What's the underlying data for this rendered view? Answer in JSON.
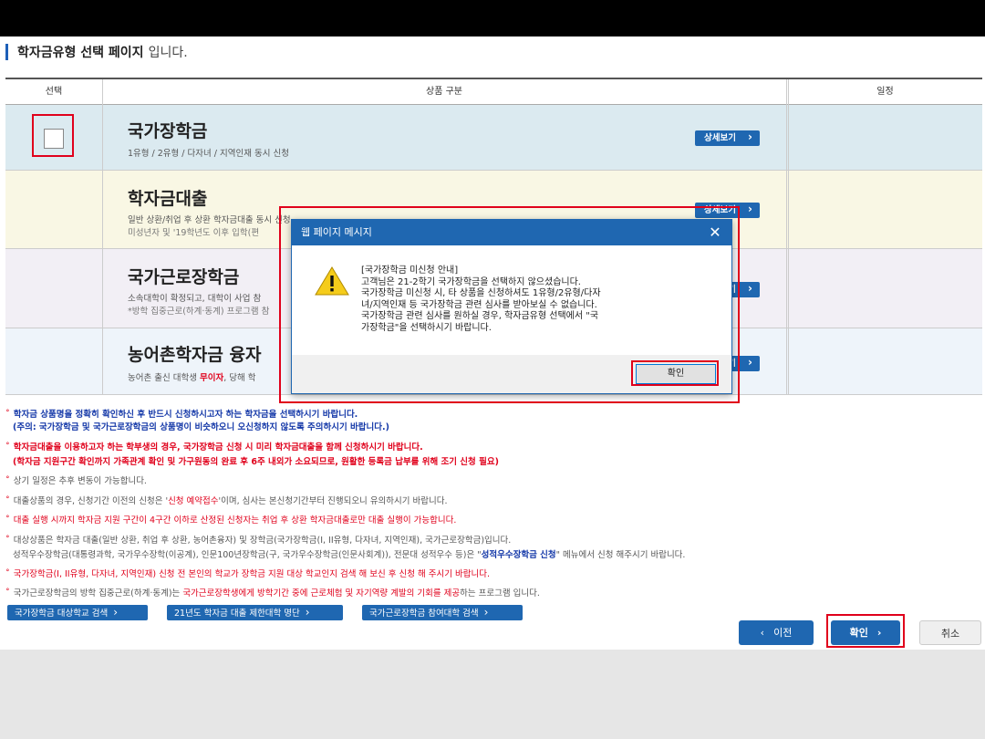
{
  "heading": {
    "title": "학자금유형 선택 페이지",
    "suffix": "입니다."
  },
  "table": {
    "col_select": "선택",
    "col_product": "상품 구분",
    "col_schedule": "일정",
    "rows": [
      {
        "name": "국가장학금",
        "desc": "1유형 / 2유형 / 다자녀 / 지역인재 동시 신청",
        "desc2": "",
        "detail": "상세보기",
        "bg": "#dbeaf0"
      },
      {
        "name": "학자금대출",
        "desc": "일반 상환/취업 후 상환 학자금대출 동시 신청",
        "desc2": "미성년자 및 '19학년도 이후 입학(편",
        "detail": "상세보기",
        "bg": "#f9f7e4"
      },
      {
        "name": "국가근로장학금",
        "desc": "소속대학이 확정되고, 대학이 사업 참",
        "desc2": "*방학 집중근로(하계·동계) 프로그램 참",
        "detail": "상세보기",
        "bg": "#f2eff5"
      },
      {
        "name": "농어촌학자금 융자",
        "desc": "농어촌 출신 대학생",
        "desc_red": "무이자",
        "desc_tail": ", 당해 학",
        "desc2": "",
        "detail": "상세보기",
        "bg": "#eef4fa"
      }
    ]
  },
  "notes": {
    "n1a": "학자금 상품명을 정확히 확인하신 후 반드시 신청하시고자 하는 학자금을 선택하시기 바랍니다.",
    "n1b": "(주의: 국가장학금 및 국가근로장학금의 상품명이 비슷하오니 오신청하지 않도록 주의하시기 바랍니다.)",
    "n2a": "학자금대출을 이용하고자 하는 학부생의 경우, 국가장학금 신청 시 미리 학자금대출을 함께 신청하시기 바랍니다.",
    "n2b": "(학자금 지원구간 확인까지 가족관계 확인 및 가구원동의 완료 후 6주 내외가 소요되므로, 원활한 등록금 납부를 위해 조기 신청 필요)",
    "n3": "상기 일정은 추후 변동이 가능합니다.",
    "n4_pre": "대출상품의 경우, 신청기간 이전의 신청은 '",
    "n4_red": "신청 예약접수",
    "n4_mid": "'이며, 심사는 본신청기간부터 진행되오니 유의하시기 바랍니다.",
    "n5": "대출 실행 시까지 학자금 지원 구간이 4구간 이하로 산정된 신청자는 취업 후 상환 학자금대출로만 대출 실행이 가능합니다.",
    "n6a": "대상상품은 학자금 대출(일반 상환, 취업 후 상환, 농어촌융자) 및 장학금(국가장학금(I, II유형, 다자녀, 지역인재), 국가근로장학금)입니다.",
    "n6b_pre": "성적우수장학금(대통령과학, 국가우수장학(이공계), 인문100년장학금(구, 국가우수장학금(인문사회계)), 전문대 성적우수 등)은 \"",
    "n6b_blue": "성적우수장학금 신청",
    "n6b_post": "\" 메뉴에서 신청 해주시기 바랍니다.",
    "n7": "국가장학금(I, II유형, 다자녀, 지역인재) 신청 전 본인의 학교가 장학금 지원 대상 학교인지 검색 해 보신 후 신청 해 주시기 바랍니다.",
    "n8_pre": "국가근로장학금의 방학 집중근로(하계·동계)는 ",
    "n8_red": "국가근로장학생에게 방학기간 중에 근로체험 및 자기역량 계발의 기회를 제공",
    "n8_post": "하는 프로그램 입니다."
  },
  "links": {
    "school_search": "국가장학금 대상학교 검색",
    "limited_univ": "21년도 학자금 대출 제한대학 명단",
    "work_univ": "국가근로장학금 참여대학 검색"
  },
  "nav": {
    "prev": "이전",
    "next": "확인",
    "cancel": "취소"
  },
  "dialog": {
    "title": "웹 페이지 메시지",
    "close": "✕",
    "lines": [
      "[국가장학금 미신청 안내]",
      "고객님은 21-2학기 국가장학금을 선택하지 않으셨습니다.",
      "국가장학금 미신청 시, 타 상품을 신청하셔도 1유형/2유형/다자",
      "녀/지역인재 등 국가장학금 관련 심사를 받아보실 수 없습니다.",
      "국가장학금 관련 심사를 원하실 경우, 학자금유형 선택에서 \"국",
      "가장학금\"을 선택하시기 바랍니다."
    ],
    "ok": "확인"
  }
}
